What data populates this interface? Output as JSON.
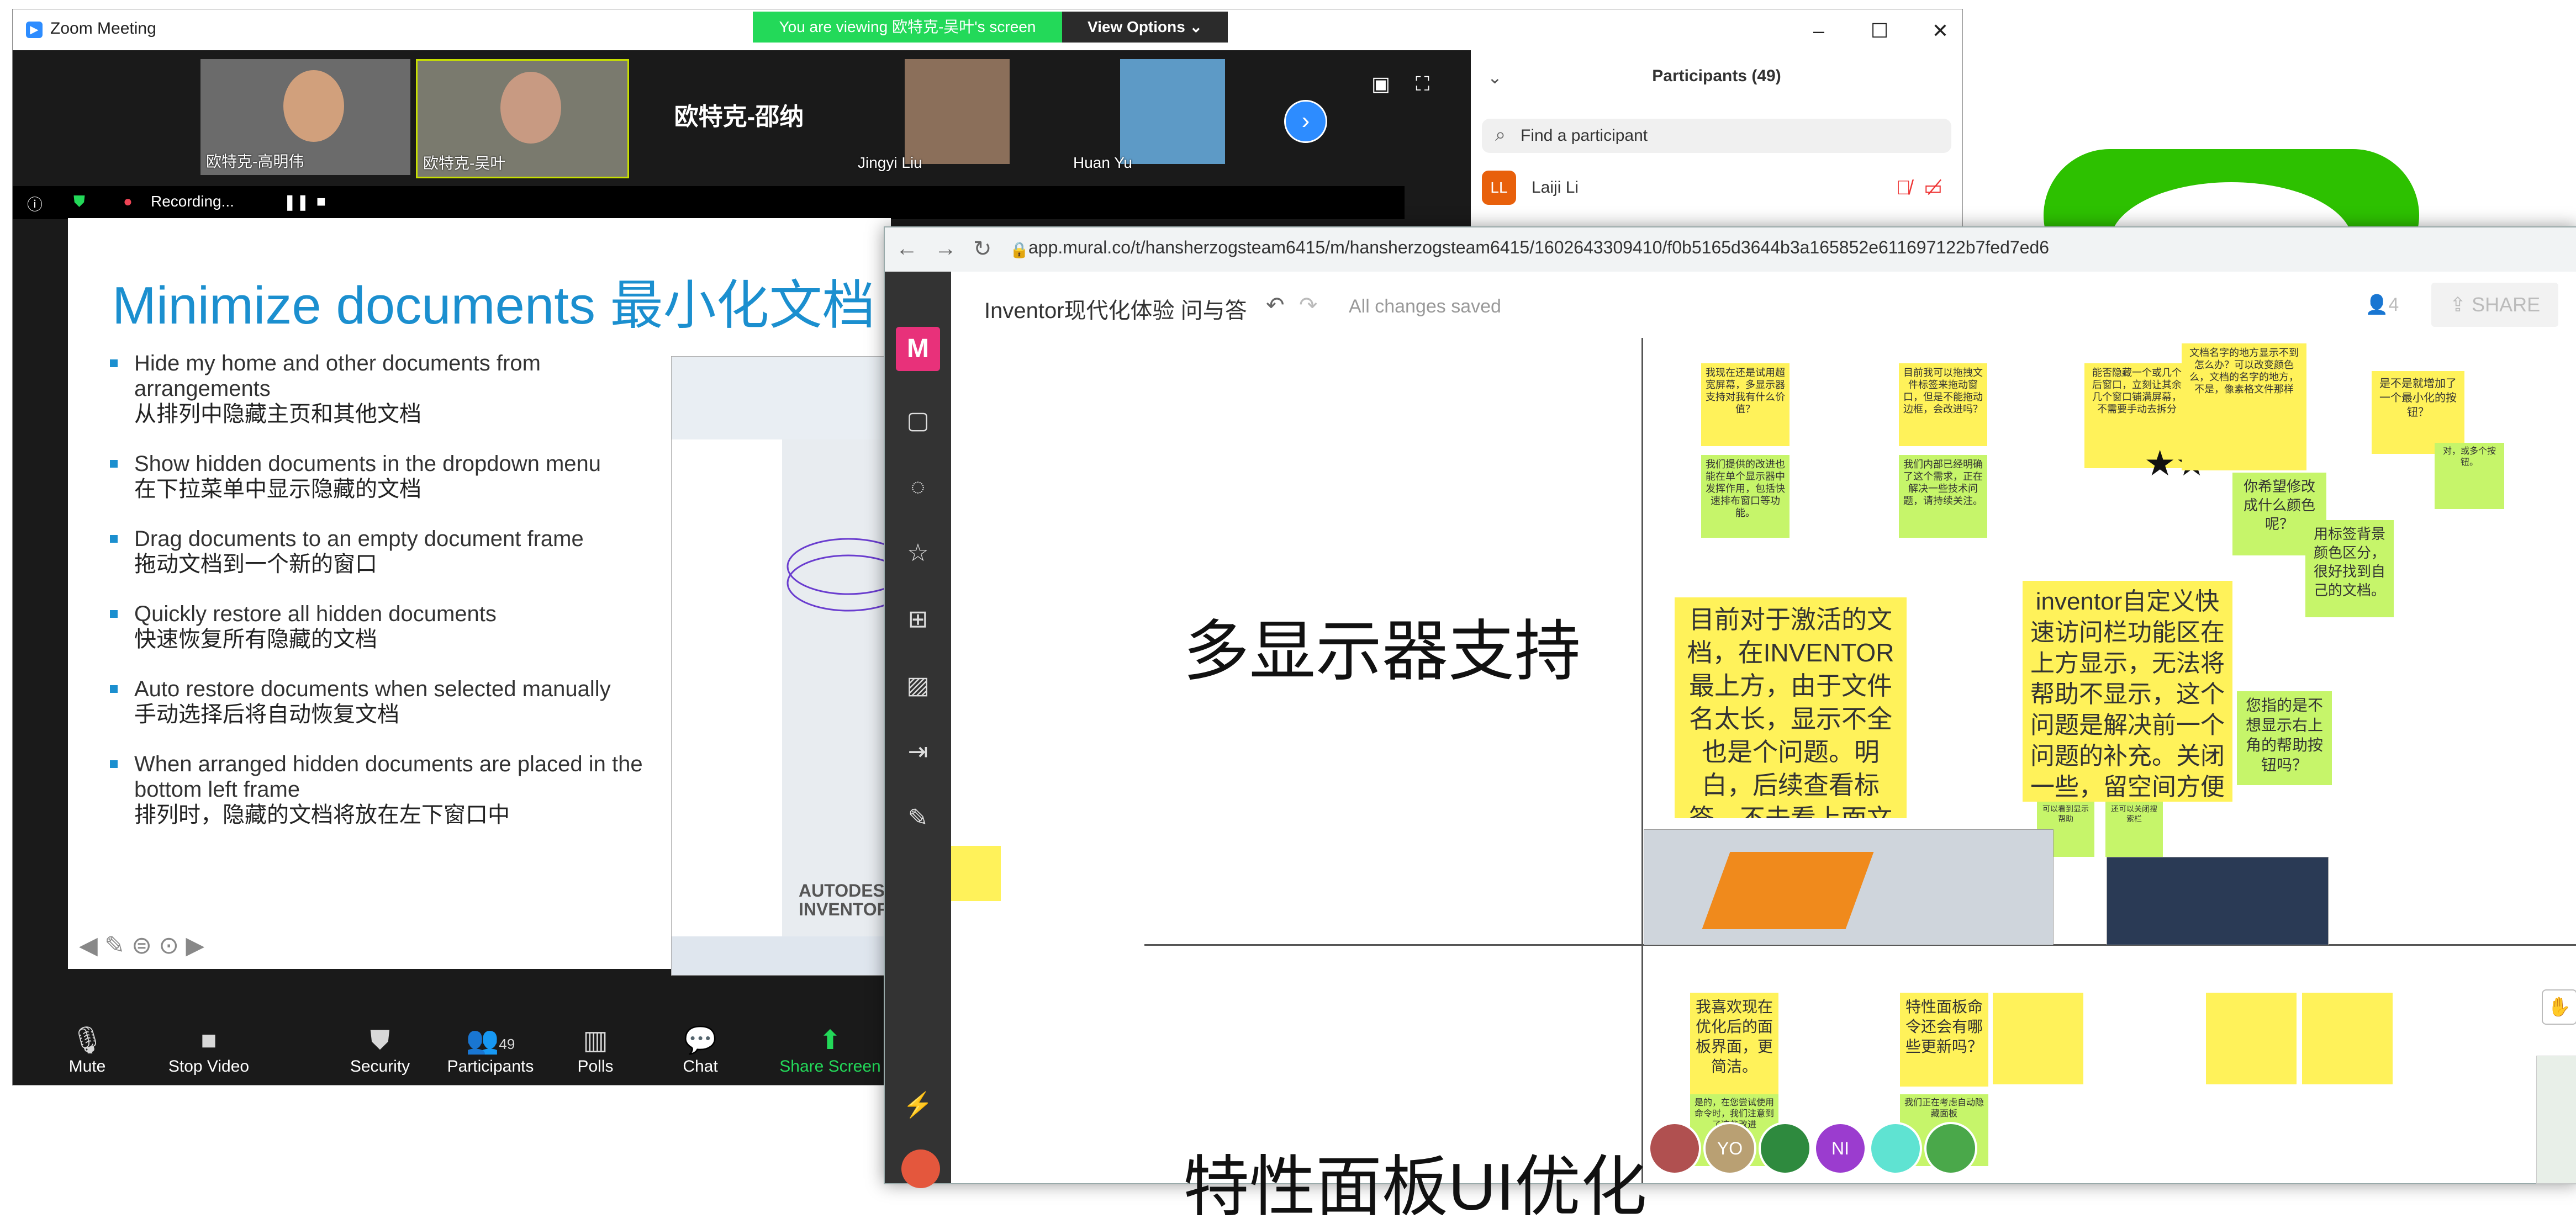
{
  "zoom": {
    "window_title": "Zoom Meeting",
    "viewing_banner": "You are viewing 欧特克-吴叶's screen",
    "view_options": "View Options ⌄",
    "thumbnails": [
      {
        "label": "欧特克-高明伟"
      },
      {
        "label": "欧特克-吴叶"
      },
      {
        "label": "欧特克-邵纳",
        "name_only": true
      },
      {
        "label": "Jingyi Liu"
      },
      {
        "label": "Huan Yu"
      }
    ],
    "recording_label": "Recording...",
    "slide": {
      "title": "Minimize documents 最小化文档",
      "bullets": [
        {
          "en": "Hide my home and other documents from arrangements",
          "cn": "从排列中隐藏主页和其他文档"
        },
        {
          "en": "Show hidden documents in the dropdown menu",
          "cn": "在下拉菜单中显示隐藏的文档"
        },
        {
          "en": "Drag documents to an empty document frame",
          "cn": "拖动文档到一个新的窗口"
        },
        {
          "en": "Quickly restore all hidden documents",
          "cn": "快速恢复所有隐藏的文档"
        },
        {
          "en": "Auto restore documents when selected manually",
          "cn": "手动选择后将自动恢复文档"
        },
        {
          "en": "When arranged hidden documents are placed in the bottom left frame",
          "cn": "排列时，隐藏的文档将放在左下窗口中"
        }
      ],
      "brand": "AUTODESK INVENTOR"
    },
    "toolbar": [
      {
        "label": "Mute",
        "icon": "microphone-icon"
      },
      {
        "label": "Stop Video",
        "icon": "camera-icon"
      },
      {
        "label": "Security",
        "icon": "shield-icon"
      },
      {
        "label": "Participants",
        "icon": "people-icon",
        "count": "49"
      },
      {
        "label": "Polls",
        "icon": "poll-icon"
      },
      {
        "label": "Chat",
        "icon": "chat-icon"
      },
      {
        "label": "Share Screen",
        "icon": "share-icon",
        "accent": "#23d959"
      }
    ],
    "panel": {
      "title": "Participants (49)",
      "search_placeholder": "Find a participant",
      "first_participant": {
        "initials": "LL",
        "name": "Laiji Li"
      }
    }
  },
  "browser": {
    "url": "app.mural.co/t/hansherzogsteam6415/m/hansherzogsteam6415/1602643309410/f0b5165d3644b3a165852e611697122b7fed7ed6",
    "mural_title": "Inventor现代化体验 问与答",
    "saved": "All changes saved",
    "users": "4",
    "share": "SHARE",
    "section1": "多显示器支持",
    "section2": "特性面板UI优化",
    "big_stickies": [
      "目前对于激活的文档，在INVENTOR最上方，由于文件名太长，显示不全也是个问题。明白，后续查看标签，不去看上面文件名。",
      "inventor自定义快速访问栏功能区在上方显示，无法将帮助不显示，这个问题是解决前一个问题的补充。关闭一些，留空间方便显示文件名。"
    ],
    "small_stickies": [
      "我现在还是试用超宽屏幕，多显示器支持对我有什么价值？",
      "我们提供的改进也能在单个显示器中发挥作用，包括快速排布窗口等功能。",
      "目前我可以拖拽文件标签来拖动窗口，但是不能拖动边框，会改进吗？",
      "我们内部已经明确了这个需求，正在解决一些技术问题，请持续关注。",
      "能否隐藏一个或几个后窗口，立刻让其余几个窗口铺满屏幕，不需要手动去拆分",
      "文档名字的地方显示不到怎么办？可以改变颜色么，文档的名字的地方，不是，像素格文件那样",
      "是不是就增加了一个最小化的按钮？",
      "对，或多个按钮。",
      "你希望修改成什么颜色呢？",
      "用标签背景颜色区分，很好找到自己的文档。",
      "您指的是不想显示右上角的帮助按钮吗？",
      "可以看到显示帮助",
      "还可以关闭搜索栏",
      "我喜欢现在优化后的面板界面，更简洁。",
      "是的，在您尝试使用命令时，我们注意到了这些改进",
      "特性面板命令还会有哪些更新吗？",
      "我们正在考虑自动隐藏面板"
    ],
    "collaborators": [
      "YO",
      "NI"
    ]
  }
}
